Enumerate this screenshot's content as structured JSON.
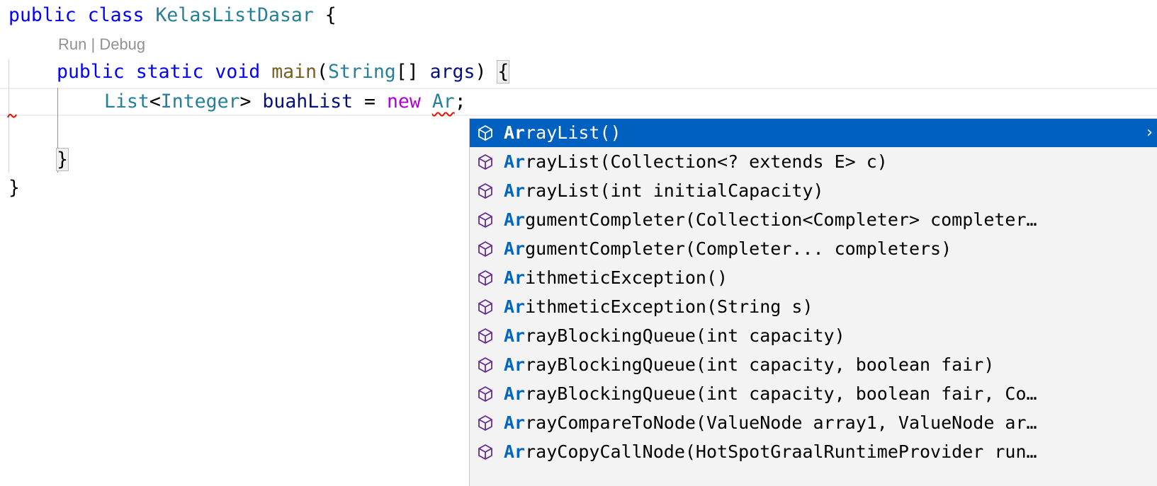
{
  "editor": {
    "lines": {
      "l1": {
        "kw1": "public",
        "kw2": "class",
        "name": "KelasListDasar",
        "brace": "{"
      },
      "l3": {
        "kw1": "public",
        "kw2": "static",
        "kw3": "void",
        "fn": "main",
        "open": "(",
        "type": "String",
        "arr": "[]",
        "param": "args",
        "close": ")",
        "brace": "{"
      },
      "l4": {
        "type1": "List",
        "lt": "<",
        "type2": "Integer",
        "gt": ">",
        "var": "buahList",
        "eq": "=",
        "kw": "new",
        "typed": "Ar",
        "semi": ";"
      },
      "l6": {
        "brace": "}"
      },
      "l7": {
        "brace": "}"
      }
    },
    "codelens": {
      "run": "Run",
      "sep": " | ",
      "debug": "Debug"
    }
  },
  "suggest": {
    "icon": "constructor-cube-icon",
    "selected_color": "#0060c0",
    "match_color": "#0066bf",
    "items": [
      {
        "match": "Ar",
        "rest": "rayList()"
      },
      {
        "match": "Ar",
        "rest": "rayList(Collection<? extends E> c)"
      },
      {
        "match": "Ar",
        "rest": "rayList(int initialCapacity)"
      },
      {
        "match": "Ar",
        "rest": "gumentCompleter(Collection<Completer> completer…"
      },
      {
        "match": "Ar",
        "rest": "gumentCompleter(Completer... completers)"
      },
      {
        "match": "Ar",
        "rest": "ithmeticException()"
      },
      {
        "match": "Ar",
        "rest": "ithmeticException(String s)"
      },
      {
        "match": "Ar",
        "rest": "rayBlockingQueue(int capacity)"
      },
      {
        "match": "Ar",
        "rest": "rayBlockingQueue(int capacity, boolean fair)"
      },
      {
        "match": "Ar",
        "rest": "rayBlockingQueue(int capacity, boolean fair, Co…"
      },
      {
        "match": "Ar",
        "rest": "rayCompareToNode(ValueNode array1, ValueNode ar…"
      },
      {
        "match": "Ar",
        "rest": "rayCopyCallNode(HotSpotGraalRuntimeProvider run…"
      }
    ],
    "chevron": "›"
  }
}
